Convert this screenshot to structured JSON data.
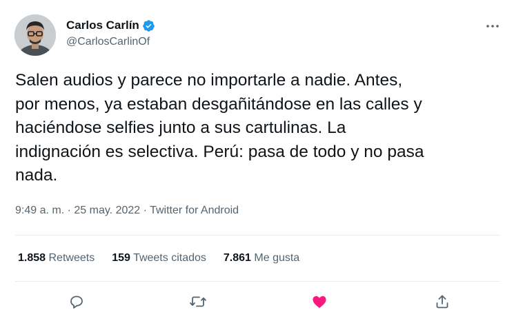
{
  "author": {
    "name": "Carlos Carlín",
    "handle": "@CarlosCarlinOf"
  },
  "tweet": {
    "text": "Salen audios y parece no importarle a nadie. Antes,\npor menos, ya estaban desgañitándose en las calles y\nhaciéndose selfies junto a sus cartulinas. La\nindignación es selectiva. Perú: pasa de todo y no pasa\nnada.",
    "time": "9:49 a. m.",
    "separator": "·",
    "date": "25 may. 2022",
    "source": "Twitter for Android"
  },
  "stats": {
    "retweets_count": "1.858",
    "retweets_label": "Retweets",
    "quotes_count": "159",
    "quotes_label": "Tweets citados",
    "likes_count": "7.861",
    "likes_label": "Me gusta"
  },
  "icons": {
    "verified": "verified-badge-icon",
    "more": "more-options-icon",
    "reply": "reply-icon",
    "retweet": "retweet-icon",
    "like": "heart-icon",
    "share": "share-icon"
  },
  "colors": {
    "verified": "#1d9bf0",
    "like": "#f91880",
    "secondary_text": "#536471",
    "divider": "#e6ecf0"
  }
}
